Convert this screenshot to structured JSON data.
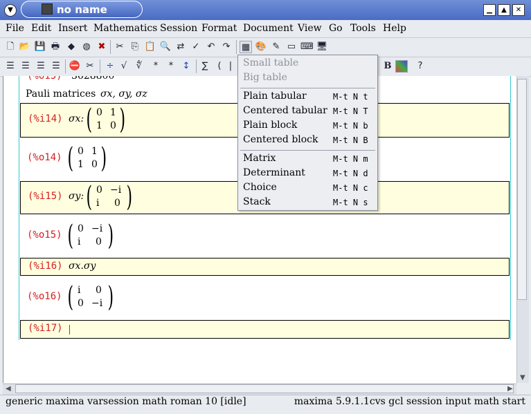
{
  "window": {
    "title": "no name"
  },
  "menubar": [
    "File",
    "Edit",
    "Insert",
    "Mathematics",
    "Session",
    "Format",
    "Document",
    "View",
    "Go",
    "Tools",
    "Help"
  ],
  "document": {
    "clipped_output": {
      "prompt": "(%o13)",
      "value": "3628800"
    },
    "text_line": {
      "prefix": "Pauli matrices",
      "symbols": "σx, σy, σz"
    },
    "cells": [
      {
        "prompt": "(%i14)",
        "kind": "input",
        "label": "σx:",
        "matrix": [
          [
            "0",
            "1"
          ],
          [
            "1",
            "0"
          ]
        ]
      },
      {
        "prompt": "(%o14)",
        "kind": "output",
        "matrix": [
          [
            "0",
            "1"
          ],
          [
            "1",
            "0"
          ]
        ]
      },
      {
        "prompt": "(%i15)",
        "kind": "input",
        "label": "σy:",
        "matrix": [
          [
            "0",
            "−i"
          ],
          [
            "i",
            "0"
          ]
        ]
      },
      {
        "prompt": "(%o15)",
        "kind": "output",
        "matrix": [
          [
            "0",
            "−i"
          ],
          [
            "i",
            "0"
          ]
        ]
      },
      {
        "prompt": "(%i16)",
        "kind": "input",
        "expression": "σx.σy"
      },
      {
        "prompt": "(%o16)",
        "kind": "output",
        "matrix": [
          [
            "i",
            "0"
          ],
          [
            "0",
            "−i"
          ]
        ]
      },
      {
        "prompt": "(%i17)",
        "kind": "input",
        "expression": ""
      }
    ]
  },
  "dropdown": {
    "items": [
      {
        "label": "Small table",
        "shortcut": "",
        "disabled": true
      },
      {
        "label": "Big table",
        "shortcut": "",
        "disabled": true
      },
      {
        "label": "Plain tabular",
        "shortcut": "M-t N t",
        "disabled": false
      },
      {
        "label": "Centered tabular",
        "shortcut": "M-t N T",
        "disabled": false
      },
      {
        "label": "Plain block",
        "shortcut": "M-t N b",
        "disabled": false
      },
      {
        "label": "Centered block",
        "shortcut": "M-t N B",
        "disabled": false
      },
      {
        "label": "Matrix",
        "shortcut": "M-t N m",
        "disabled": false
      },
      {
        "label": "Determinant",
        "shortcut": "M-t N d",
        "disabled": false
      },
      {
        "label": "Choice",
        "shortcut": "M-t N c",
        "disabled": false
      },
      {
        "label": "Stack",
        "shortcut": "M-t N s",
        "disabled": false
      }
    ]
  },
  "toolbar2": {
    "bold_letter": "B"
  },
  "statusbar": {
    "left": "generic maxima varsession math roman 10 [idle]",
    "right": "maxima 5.9.1.1cvs gcl session input math start"
  },
  "colors": {
    "prompt": "#d42020",
    "input_bg": "#ffffe0",
    "guide": "#33c8d0",
    "titlebar": "#4a6cc4"
  }
}
